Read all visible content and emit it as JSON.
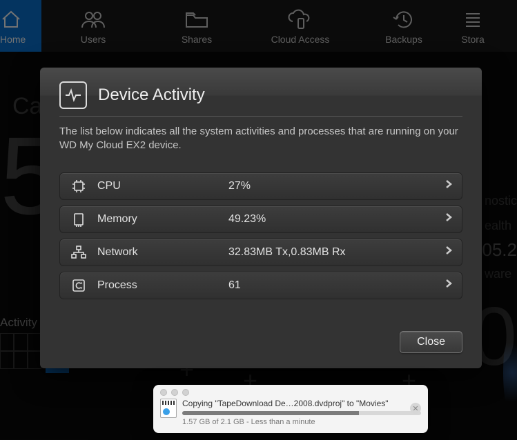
{
  "nav": {
    "items": [
      {
        "label": "Home"
      },
      {
        "label": "Users"
      },
      {
        "label": "Shares"
      },
      {
        "label": "Cloud Access"
      },
      {
        "label": "Backups"
      },
      {
        "label": "Stora"
      }
    ]
  },
  "bg": {
    "capacity_label_partial": "Ca",
    "big_number": "5",
    "right_line1": "nostic",
    "right_line2": "ealth",
    "right_line3": "ware",
    "right_version_partial": "05.2",
    "big_zero": "0",
    "activity_label": "Activity",
    "plus1": "+",
    "plus2": "+",
    "plus3": "+"
  },
  "modal": {
    "title": "Device Activity",
    "description": "The list below indicates all the system activities and processes that are running on your WD My Cloud EX2 device.",
    "rows": [
      {
        "label": "CPU",
        "value": "27%"
      },
      {
        "label": "Memory",
        "value": "49.23%"
      },
      {
        "label": "Network",
        "value": "32.83MB Tx,0.83MB Rx"
      },
      {
        "label": "Process",
        "value": "61"
      }
    ],
    "close_label": "Close"
  },
  "copy": {
    "title": "Copying \"TapeDownload De…2008.dvdproj\" to \"Movies\"",
    "sub": "1.57 GB of 2.1 GB - Less than a minute",
    "progress_percent": 74
  }
}
